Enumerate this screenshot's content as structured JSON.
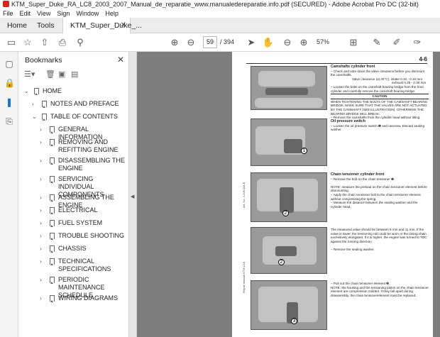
{
  "window": {
    "title": "KTM_Super_Duke_RA_LC8_2003_2007_Manual_de_reparatie_www.manualedereparatie.info.pdf (SECURED) - Adobe Acrobat Pro DC (32-bit)"
  },
  "menu": [
    "File",
    "Edit",
    "View",
    "Sign",
    "Window",
    "Help"
  ],
  "tabs": {
    "home": "Home",
    "tools": "Tools",
    "doc": "KTM_Super_Duke_..."
  },
  "toolbar": {
    "page_current": "59",
    "page_total": "/ 394",
    "zoom": "57%"
  },
  "bookmarks": {
    "title": "Bookmarks",
    "items": [
      {
        "label": "HOME",
        "level": 0,
        "expanded": true
      },
      {
        "label": "NOTES AND PREFACE",
        "level": 1,
        "expanded": false
      },
      {
        "label": "TABLE OF CONTENTS",
        "level": 1,
        "expanded": true
      },
      {
        "label": "GENERAL INFORMATION",
        "level": 2,
        "expanded": false
      },
      {
        "label": "REMOVING AND REFITTING ENGINE",
        "level": 2,
        "expanded": false
      },
      {
        "label": "DISASSEMBLING THE ENGINE",
        "level": 2,
        "expanded": false
      },
      {
        "label": "SERVICING INDIVIDUAL COMPONENTS",
        "level": 2,
        "expanded": false
      },
      {
        "label": "ASSEMBLING THE ENGINE",
        "level": 2,
        "expanded": false
      },
      {
        "label": "ELECTRICAL",
        "level": 2,
        "expanded": false
      },
      {
        "label": "FUEL SYSTEM",
        "level": 2,
        "expanded": false
      },
      {
        "label": "TROUBLE SHOOTING",
        "level": 2,
        "expanded": false
      },
      {
        "label": "CHASSIS",
        "level": 2,
        "expanded": false
      },
      {
        "label": "TECHNICAL SPECIFICATIONS",
        "level": 2,
        "expanded": false
      },
      {
        "label": "PERIODIC MAINTENANCE SCHEDULE",
        "level": 2,
        "expanded": false
      },
      {
        "label": "WIRING DIAGRAMS",
        "level": 2,
        "expanded": false
      }
    ]
  },
  "page": {
    "number": "4-6",
    "section1": {
      "heading": "Camshafts cylinder front",
      "lines": [
        "– Check and note down the valve clearance before you dismount the camshafts.",
        "Valve clearance (at 20°C): intake 0.10 - 0.15 mm",
        "exhaust 0.25 - 0.30 mm",
        "– Loosen the bolts on the camshaft bearing bridge from the front cylinder and carefully remove the camshaft bearing bridge.",
        "CAUTION",
        "WHEN TIGHTENING THE BOLTS OF THE CAMSHAFT BEARING BRIDGE, MAKE SURE THAT THE VALVES ARE NOT ACTUATED BY THE CAMSHAFT (SEE ILLUSTRATION), OTHERWISE THE BEARING BRIDGE WILL BREAK.",
        "– Remove the camshafts from the cylinder head without tilting."
      ]
    },
    "section2": {
      "heading": "Oil pressure switch",
      "lines": [
        "– Loosen the oil pressure switch ❶ and unscrew. Discard sealing washer."
      ]
    },
    "section3": {
      "heading": "Chain tensioner cylinder front",
      "lines": [
        "– Remove the bolt on the chain tensioner ❷.",
        "NOTE: measure the preload on the chain tensioner element before dismounting.",
        "– Apply the chain tensioner bolt to the chain tensioner element without compressing the spring.",
        "– Measure the distance between the sealing washer and the cylinder head."
      ]
    },
    "section4": {
      "lines": [
        "The measured value should be between 6 mm and 11 mm. If the value is lower, the tensioning rail could be worn or the timing chain excessively elongated. If it is higher, the engine was turned to TDC against the running direction.",
        "– Remove the sealing washer."
      ]
    },
    "section5": {
      "lines": [
        "– Pull out the chain tensioner element ❸.",
        "NOTE: the housing and the tensioning piston on the chain tensioner element are compression molded. If they fall apart during disassembly, the chain tensionerelement must be replaced."
      ]
    },
    "callouts": [
      "1",
      "2",
      "2",
      "3"
    ],
    "side_label_1": "Art. No. 3.206.044-E",
    "side_label_2": "Repair manual   KTM LC8"
  }
}
